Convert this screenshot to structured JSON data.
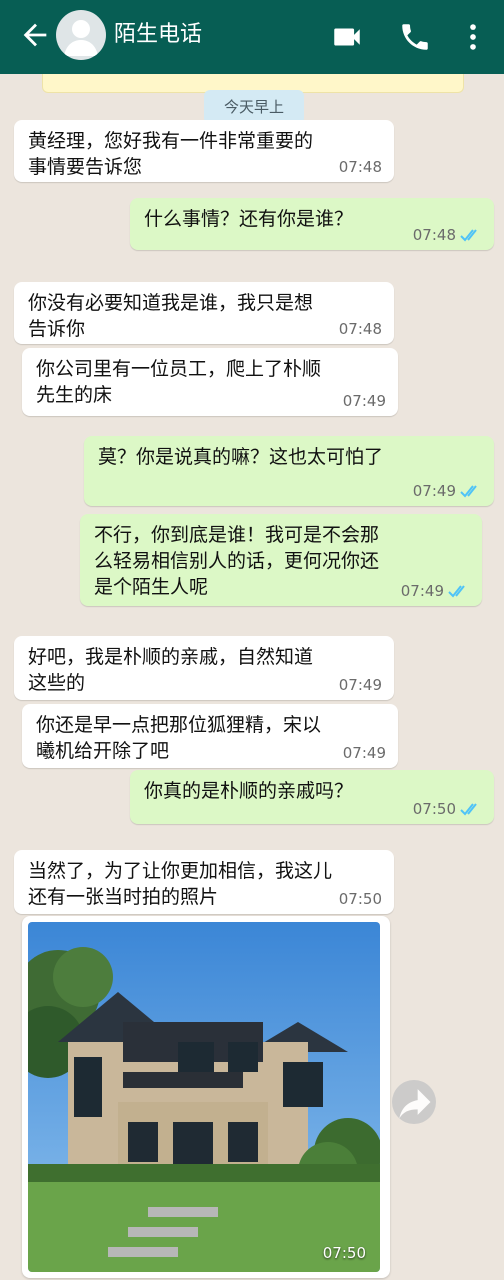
{
  "header": {
    "contact_name": "陌生电话",
    "icons": [
      "back-arrow-icon",
      "avatar",
      "video-call-icon",
      "voice-call-icon",
      "more-options-icon"
    ]
  },
  "chat": {
    "date_label": "今天早上",
    "messages": [
      {
        "dir": "in",
        "text": "黄经理，您好我有一件非常重要的事情要告诉您",
        "time": "07:48"
      },
      {
        "dir": "out",
        "text": "什么事情？还有你是谁？",
        "time": "07:48",
        "status": "read"
      },
      {
        "dir": "in",
        "text": "你没有必要知道我是谁，我只是想告诉你",
        "time": "07:48"
      },
      {
        "dir": "in",
        "text": "你公司里有一位员工，爬上了朴顺先生的床",
        "time": "07:49"
      },
      {
        "dir": "out",
        "text": "莫？你是说真的嘛？这也太可怕了",
        "time": "07:49",
        "status": "read"
      },
      {
        "dir": "out",
        "text": "不行，你到底是谁！我可是不会那么轻易相信别人的话，更何况你还是个陌生人呢",
        "time": "07:49",
        "status": "read"
      },
      {
        "dir": "in",
        "text": "好吧，我是朴顺的亲戚，自然知道这些的",
        "time": "07:49"
      },
      {
        "dir": "in",
        "text": "你还是早一点把那位狐狸精，宋以曦机给开除了吧",
        "time": "07:49"
      },
      {
        "dir": "out",
        "text": "你真的是朴顺的亲戚吗？",
        "time": "07:50",
        "status": "read"
      },
      {
        "dir": "in",
        "text": "当然了，为了让你更加相信，我这儿还有一张当时拍的照片",
        "time": "07:50"
      },
      {
        "dir": "in",
        "type": "image",
        "time": "07:50",
        "image_desc_icon": "house-photo"
      }
    ]
  },
  "colors": {
    "header": "#075e54",
    "chat_bg": "#ece5dd",
    "incoming": "#ffffff",
    "outgoing": "#dcf8c6",
    "read_tick": "#4fc3f7"
  }
}
